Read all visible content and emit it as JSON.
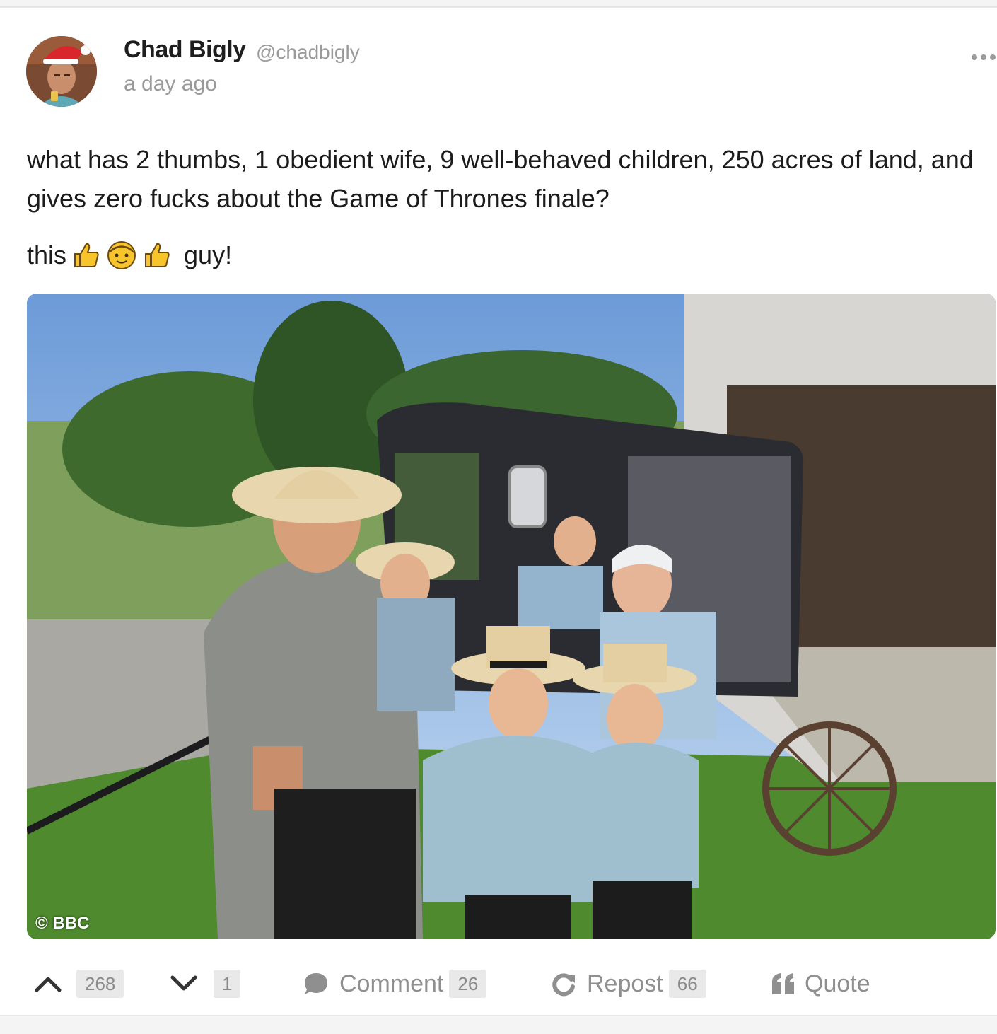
{
  "post": {
    "author_name": "Chad Bigly",
    "handle": "@chadbigly",
    "timestamp": "a day ago",
    "text_line1": "what has 2 thumbs, 1 obedient wife, 9 well-behaved children, 250 acres of land, and gives zero fucks about the Game of Thrones finale?",
    "text_line2_before": "this",
    "text_line2_after": "guy!",
    "emojis": [
      "thumbs-up-icon",
      "older-man-face-icon",
      "thumbs-up-icon"
    ],
    "image_watermark": "© BBC"
  },
  "actions": {
    "upvote_count": "268",
    "downvote_count": "1",
    "comment_label": "Comment",
    "comment_count": "26",
    "repost_label": "Repost",
    "repost_count": "66",
    "quote_label": "Quote"
  },
  "colors": {
    "muted_text": "#9a9a9a",
    "count_bg": "#e9e9e9",
    "emoji_yellow": "#f7c52b"
  }
}
